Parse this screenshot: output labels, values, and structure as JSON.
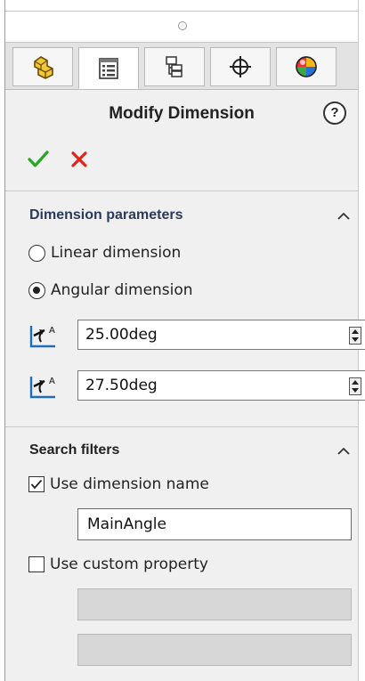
{
  "panel": {
    "title": "Modify Dimension",
    "help_label": "?"
  },
  "tabs": [
    {
      "icon": "part-feature-icon",
      "active": false
    },
    {
      "icon": "property-manager-icon",
      "active": true
    },
    {
      "icon": "configuration-manager-icon",
      "active": false
    },
    {
      "icon": "dimxpert-target-icon",
      "active": false
    },
    {
      "icon": "display-manager-icon",
      "active": false
    }
  ],
  "actions": {
    "ok_icon": "checkmark-icon",
    "cancel_icon": "x-icon",
    "ok_color": "#2aa52a",
    "cancel_color": "#e0241b"
  },
  "dimension_parameters": {
    "title": "Dimension parameters",
    "options": [
      {
        "label": "Linear dimension",
        "checked": false
      },
      {
        "label": "Angular dimension",
        "checked": true
      }
    ],
    "values": [
      {
        "value": "25.00deg",
        "icon": "angle-dimension-icon"
      },
      {
        "value": "27.50deg",
        "icon": "angle-dimension-icon"
      }
    ]
  },
  "search_filters": {
    "title": "Search filters",
    "use_dimension_name": {
      "label": "Use dimension name",
      "checked": true
    },
    "dimension_name_value": "MainAngle",
    "use_custom_property": {
      "label": "Use custom property",
      "checked": false
    }
  }
}
